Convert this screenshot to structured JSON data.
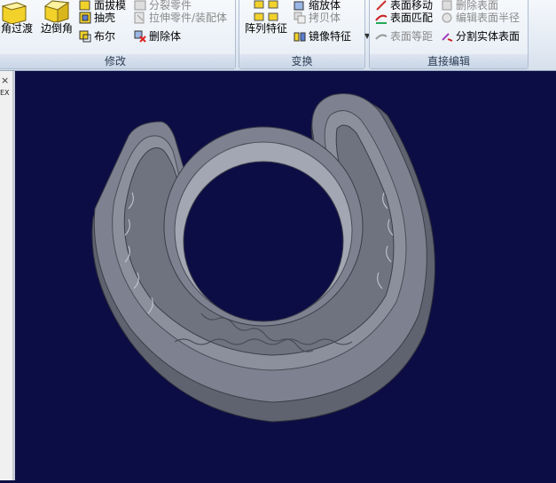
{
  "ribbon": {
    "modify": {
      "title": "修改",
      "fillet_label": "圆角过渡",
      "chamfer_label": "边倒角",
      "draft_label": "面拔模",
      "shell_label": "抽壳",
      "boolean_label": "布尔",
      "split_label": "分裂零件",
      "extrude_label": "拉伸零件/装配体",
      "delete_body_label": "删除体"
    },
    "transform": {
      "title": "变换",
      "array_label": "阵列特征",
      "scale_label": "缩放体",
      "copy_label": "拷贝体",
      "mirror_label": "镜像特征"
    },
    "direct_edit": {
      "title": "直接编辑",
      "move_face_label": "表面移动",
      "delete_face_label": "删除表面",
      "match_face_label": "表面匹配",
      "edit_radius_label": "编辑表面半径",
      "offset_face_label": "表面等距",
      "split_solid_label": "分割实体表面"
    }
  },
  "left_panel": {
    "close_glyph": "×",
    "tab_label": "EX"
  },
  "colors": {
    "viewport_bg": "#0d0d45",
    "part_fill": "#7e8290",
    "part_dark": "#5f6370",
    "part_light": "#a3a7b3",
    "icon_yellow": "#f2d22a"
  }
}
